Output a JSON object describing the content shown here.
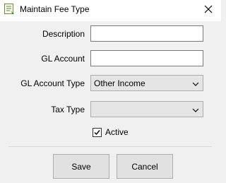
{
  "window": {
    "title": "Maintain Fee Type",
    "icon": "form-app-icon",
    "close_icon": "close-icon"
  },
  "form": {
    "description_label": "Description",
    "description_value": "",
    "gl_account_label": "GL Account",
    "gl_account_value": "",
    "gl_account_type_label": "GL Account Type",
    "gl_account_type_value": "Other Income",
    "tax_type_label": "Tax Type",
    "tax_type_value": "",
    "active_label": "Active",
    "active_checked": true
  },
  "buttons": {
    "save_label": "Save",
    "cancel_label": "Cancel"
  }
}
